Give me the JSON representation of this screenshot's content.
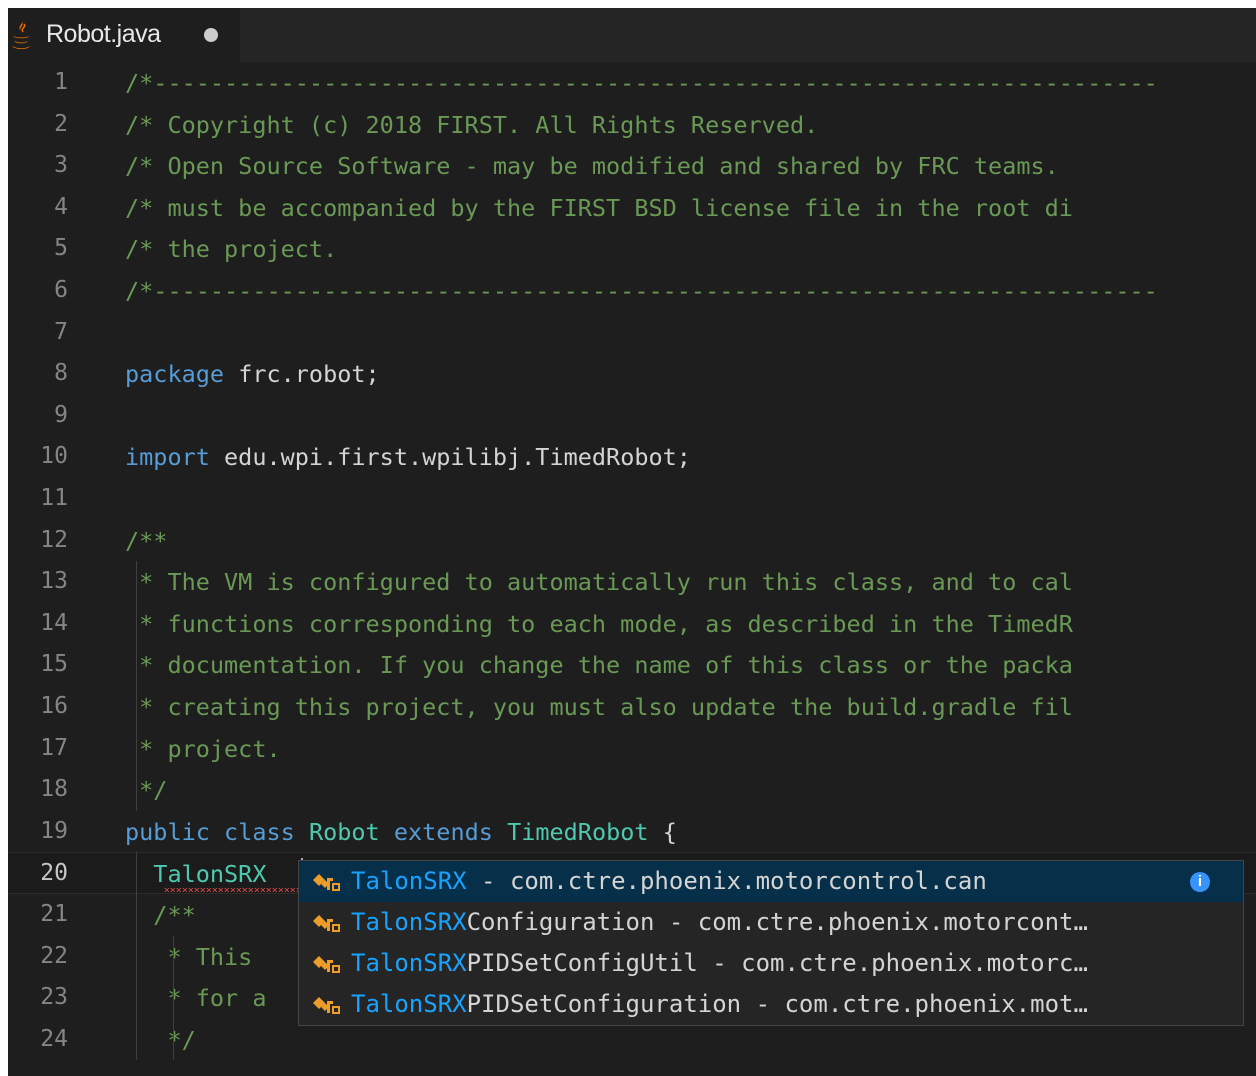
{
  "tab": {
    "filename": "Robot.java",
    "dirty_indicator": "●"
  },
  "editor": {
    "active_line": 20,
    "lines": [
      {
        "n": "1",
        "tokens": [
          {
            "t": "/*-----------------------------------------------------------------------",
            "c": "com"
          }
        ]
      },
      {
        "n": "2",
        "tokens": [
          {
            "t": "/* Copyright (c) 2018 FIRST. All Rights Reserved.",
            "c": "com"
          }
        ]
      },
      {
        "n": "3",
        "tokens": [
          {
            "t": "/* Open Source Software - may be modified and shared by FRC teams. ",
            "c": "com"
          }
        ]
      },
      {
        "n": "4",
        "tokens": [
          {
            "t": "/* must be accompanied by the FIRST BSD license file in the root di",
            "c": "com"
          }
        ]
      },
      {
        "n": "5",
        "tokens": [
          {
            "t": "/* the project.",
            "c": "com"
          }
        ]
      },
      {
        "n": "6",
        "tokens": [
          {
            "t": "/*-----------------------------------------------------------------------",
            "c": "com"
          }
        ]
      },
      {
        "n": "7",
        "tokens": []
      },
      {
        "n": "8",
        "tokens": [
          {
            "t": "package",
            "c": "kw"
          },
          {
            "t": " frc.robot;",
            "c": "txt"
          }
        ]
      },
      {
        "n": "9",
        "tokens": []
      },
      {
        "n": "10",
        "tokens": [
          {
            "t": "import",
            "c": "kw"
          },
          {
            "t": " edu.wpi.first.wpilibj.TimedRobot;",
            "c": "txt"
          }
        ]
      },
      {
        "n": "11",
        "tokens": []
      },
      {
        "n": "12",
        "tokens": [
          {
            "t": "/**",
            "c": "com"
          }
        ]
      },
      {
        "n": "13",
        "tokens": [
          {
            "t": " * The VM is configured to automatically run this class, and to cal",
            "c": "com"
          }
        ]
      },
      {
        "n": "14",
        "tokens": [
          {
            "t": " * functions corresponding to each mode, as described in the TimedR",
            "c": "com"
          }
        ]
      },
      {
        "n": "15",
        "tokens": [
          {
            "t": " * documentation. If you change the name of this class or the packa",
            "c": "com"
          }
        ]
      },
      {
        "n": "16",
        "tokens": [
          {
            "t": " * creating this project, you must also update the build.gradle fil",
            "c": "com"
          }
        ]
      },
      {
        "n": "17",
        "tokens": [
          {
            "t": " * project.",
            "c": "com"
          }
        ]
      },
      {
        "n": "18",
        "tokens": [
          {
            "t": " */",
            "c": "com"
          }
        ]
      },
      {
        "n": "19",
        "tokens": [
          {
            "t": "public",
            "c": "kw"
          },
          {
            "t": " ",
            "c": "txt"
          },
          {
            "t": "class",
            "c": "kw"
          },
          {
            "t": " ",
            "c": "txt"
          },
          {
            "t": "Robot",
            "c": "cls"
          },
          {
            "t": " ",
            "c": "txt"
          },
          {
            "t": "extends",
            "c": "kw"
          },
          {
            "t": " ",
            "c": "txt"
          },
          {
            "t": "TimedRobot",
            "c": "cls"
          },
          {
            "t": " {",
            "c": "txt"
          }
        ]
      },
      {
        "n": "20",
        "tokens": [
          {
            "t": "  TalonSRX",
            "c": "cls"
          }
        ]
      },
      {
        "n": "21",
        "tokens": [
          {
            "t": "  /**",
            "c": "com"
          }
        ]
      },
      {
        "n": "22",
        "tokens": [
          {
            "t": "   * This ",
            "c": "com"
          },
          {
            "t": "                                                          h",
            "c": "com"
          }
        ]
      },
      {
        "n": "23",
        "tokens": [
          {
            "t": "   * for a",
            "c": "com"
          }
        ]
      },
      {
        "n": "24",
        "tokens": [
          {
            "t": "   */",
            "c": "com"
          }
        ]
      }
    ]
  },
  "suggestions": {
    "typed_prefix": "TalonSRX",
    "items": [
      {
        "match": "TalonSRX",
        "rest": " - com.ctre.phoenix.motorcontrol.can",
        "icon": "class-icon",
        "selected": true
      },
      {
        "match": "TalonSRX",
        "rest": "Configuration - com.ctre.phoenix.motorcont…",
        "icon": "class-icon",
        "selected": false
      },
      {
        "match": "TalonSRX",
        "rest": "PIDSetConfigUtil - com.ctre.phoenix.motorc…",
        "icon": "class-icon",
        "selected": false
      },
      {
        "match": "TalonSRX",
        "rest": "PIDSetConfiguration - com.ctre.phoenix.mot…",
        "icon": "class-icon",
        "selected": false
      }
    ],
    "info_glyph": "i"
  },
  "colors": {
    "comment": "#6a9955",
    "keyword": "#569cd6",
    "type": "#4ec9b0",
    "match": "#18a3ff",
    "selection": "#062f4a"
  }
}
